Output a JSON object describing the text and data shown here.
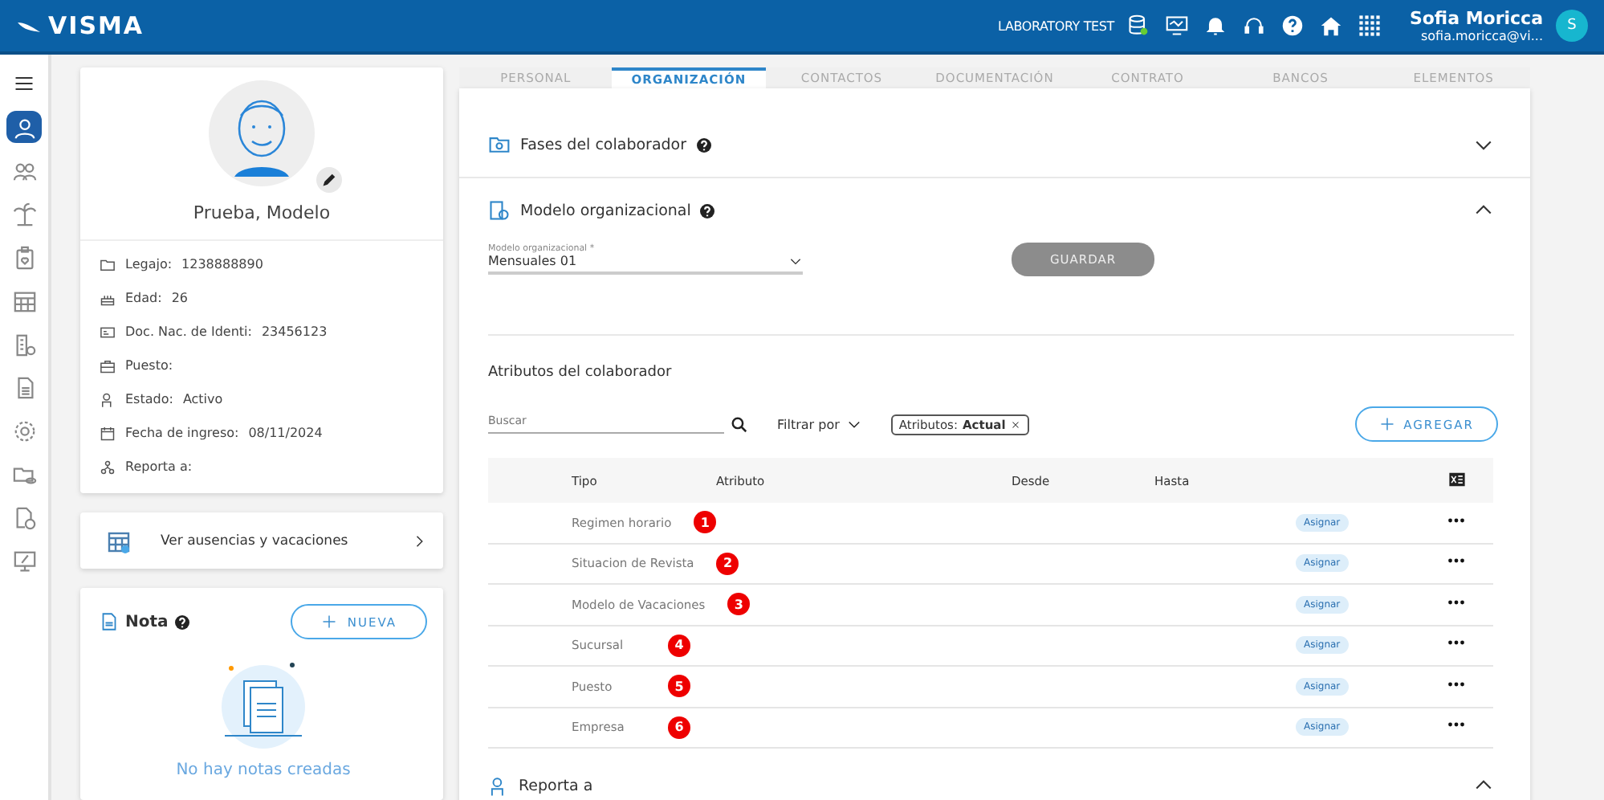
{
  "header": {
    "brand": "VISMA",
    "environment": "LABORATORY TEST",
    "user_name": "Sofia Moricca",
    "user_email": "sofia.moricca@vi...",
    "avatar_initial": "S"
  },
  "sidebar": {
    "items": [
      {
        "selected": true
      },
      {
        "selected": false
      },
      {
        "selected": false
      },
      {
        "selected": false
      },
      {
        "selected": false
      },
      {
        "selected": false
      },
      {
        "selected": false
      },
      {
        "selected": false
      },
      {
        "selected": false
      },
      {
        "selected": false
      },
      {
        "selected": false
      }
    ]
  },
  "profile": {
    "name": "Prueba, Modelo",
    "fields": [
      {
        "label": "Legajo:",
        "value": "1238888890"
      },
      {
        "label": "Edad:",
        "value": "26"
      },
      {
        "label": "Doc. Nac. de Identi:",
        "value": "23456123"
      },
      {
        "label": "Puesto:"
      },
      {
        "label": "Estado:",
        "value": "Activo"
      },
      {
        "label": "Fecha de ingreso:",
        "value": "08/11/2024"
      },
      {
        "label": "Reporta a:"
      }
    ]
  },
  "absences_link": "Ver ausencias y vacaciones",
  "notes": {
    "title": "Nota",
    "new_button": "NUEVA",
    "empty_text": "No hay notas creadas"
  },
  "tabs": [
    {
      "label": "PERSONAL",
      "selected": false
    },
    {
      "label": "ORGANIZACIÓN",
      "selected": true
    },
    {
      "label": "CONTACTOS",
      "selected": false
    },
    {
      "label": "DOCUMENTACIÓN",
      "selected": false
    },
    {
      "label": "CONTRATO",
      "selected": false
    },
    {
      "label": "BANCOS",
      "selected": false
    },
    {
      "label": "ELEMENTOS",
      "selected": false
    }
  ],
  "sections": [
    {
      "title": "Fases del colaborador",
      "expanded": false
    },
    {
      "title": "Modelo organizacional",
      "expanded": true
    }
  ],
  "org_model": {
    "field_label": "Modelo organizacional *",
    "value": "Mensuales 01",
    "save_button": "GUARDAR"
  },
  "attributes": {
    "title": "Atributos del colaborador",
    "search_placeholder": "Buscar",
    "filter_label": "Filtrar por",
    "filter_chip_label": "Atributos:",
    "filter_chip_value": "Actual",
    "add_button": "AGREGAR",
    "columns": [
      "Tipo",
      "Atributo",
      "Desde",
      "Hasta"
    ],
    "rows": [
      {
        "tipo": "Regimen horario",
        "marker": "1",
        "action": "Asignar"
      },
      {
        "tipo": "Situacion de Revista",
        "marker": "2",
        "action": "Asignar"
      },
      {
        "tipo": "Modelo de Vacaciones",
        "marker": "3",
        "action": "Asignar"
      },
      {
        "tipo": "Sucursal",
        "marker": "4",
        "action": "Asignar"
      },
      {
        "tipo": "Puesto",
        "marker": "5",
        "action": "Asignar"
      },
      {
        "tipo": "Empresa",
        "marker": "6",
        "action": "Asignar"
      }
    ]
  },
  "reporta_section": {
    "title": "Reporta a",
    "expanded": true
  }
}
